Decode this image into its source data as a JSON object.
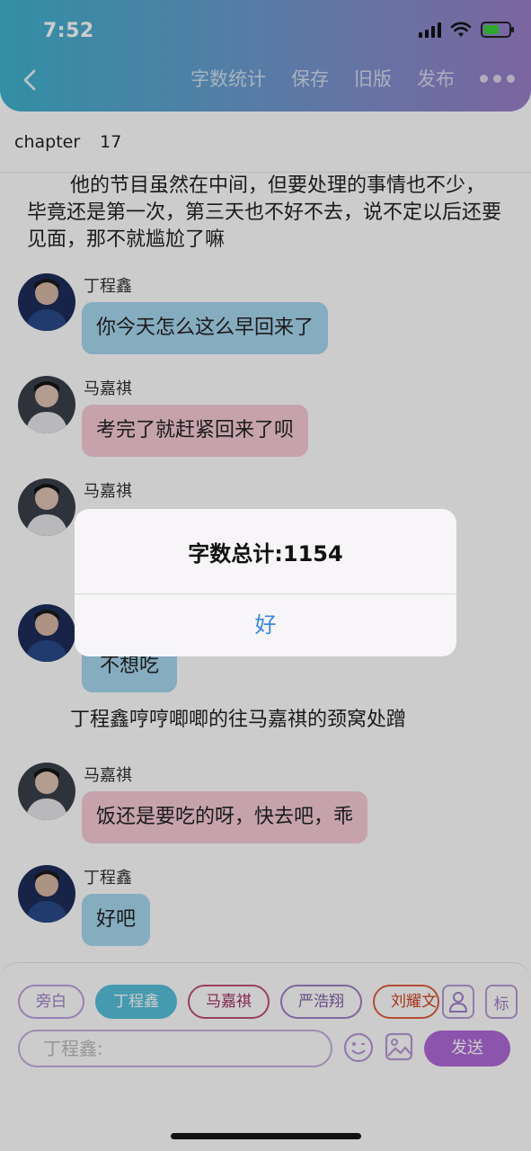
{
  "status": {
    "time": "7:52"
  },
  "nav": {
    "actions": [
      "字数统计",
      "保存",
      "旧版",
      "发布"
    ]
  },
  "chapter": {
    "label": "chapter",
    "number": "17"
  },
  "narration": [
    "他的节目虽然在中间，但要处理的事情也不少，毕竟还是第一次，第三天也不好不去，说不定以后还要见面，那不就尴尬了嘛",
    "丁程鑫哼哼唧唧的往马嘉祺的颈窝处蹭"
  ],
  "messages": [
    {
      "name": "丁程鑫",
      "text": "你今天怎么这么早回来了",
      "color": "blue"
    },
    {
      "name": "马嘉祺",
      "text": "考完了就赶紧回来了呗",
      "color": "pink"
    },
    {
      "name": "马嘉祺",
      "text": "",
      "color": "pink"
    },
    {
      "name": "",
      "text": "不想吃",
      "color": "blue"
    },
    {
      "name": "马嘉祺",
      "text": "饭还是要吃的呀，快去吧，乖",
      "color": "pink"
    },
    {
      "name": "丁程鑫",
      "text": "好吧",
      "color": "blue"
    }
  ],
  "dialog": {
    "title": "字数总计:1154",
    "button": "好"
  },
  "chips": [
    "旁白",
    "丁程鑫",
    "马嘉祺",
    "严浩翔",
    "刘耀文"
  ],
  "panel_icons": {
    "person": "person-icon",
    "mark": "标"
  },
  "input": {
    "placeholder": "丁程鑫:"
  },
  "send": {
    "label": "发送"
  },
  "colors": {
    "blue_bubble": "#a8d8f0",
    "pink_bubble": "#f8ccd8",
    "send": "#b06ad8",
    "dialog_button": "#3a86e0"
  }
}
